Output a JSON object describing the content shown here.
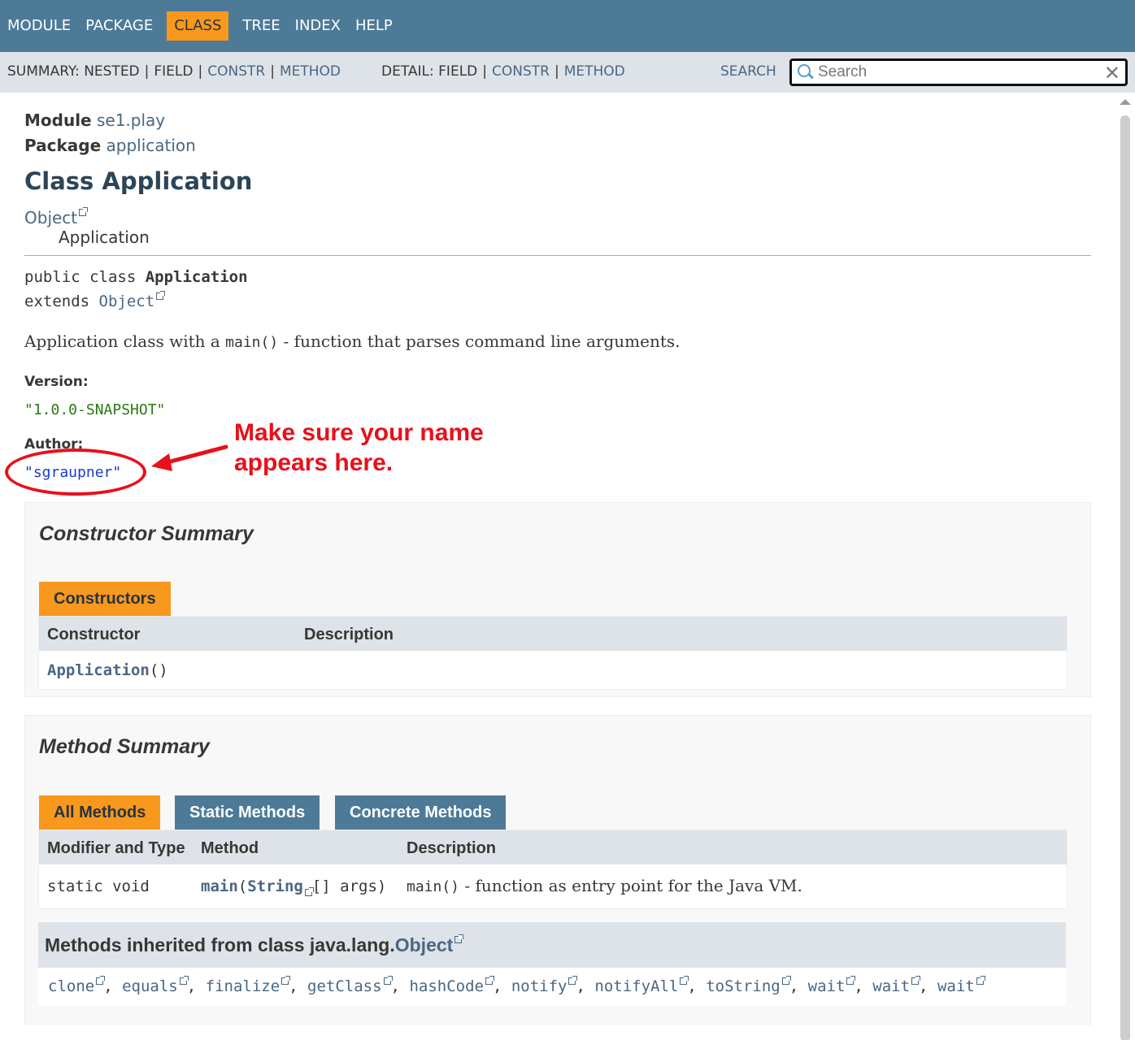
{
  "nav": {
    "items": [
      "MODULE",
      "PACKAGE",
      "CLASS",
      "TREE",
      "INDEX",
      "HELP"
    ],
    "active": "CLASS"
  },
  "subnav": {
    "summary_label": "SUMMARY:",
    "summary_items": [
      "NESTED",
      "FIELD",
      "CONSTR",
      "METHOD"
    ],
    "detail_label": "DETAIL:",
    "detail_items": [
      "FIELD",
      "CONSTR",
      "METHOD"
    ],
    "search_label": "SEARCH",
    "search_placeholder": "Search"
  },
  "header": {
    "module_label": "Module",
    "module_name": "se1.play",
    "package_label": "Package",
    "package_name": "application",
    "class_title": "Class Application",
    "inheritance": [
      "Object",
      "Application"
    ]
  },
  "signature": {
    "line1_prefix": "public class ",
    "line1_name": "Application",
    "line2_prefix": "extends ",
    "line2_link": "Object"
  },
  "description": {
    "pre": "Application class with a ",
    "code": "main()",
    "post": " - function that parses command line arguments."
  },
  "tags": {
    "version_label": "Version:",
    "version_value": "\"1.0.0-SNAPSHOT\"",
    "author_label": "Author:",
    "author_value": "\"sgraupner\""
  },
  "annotation": {
    "text_line1": "Make sure your name",
    "text_line2": "appears here.",
    "color": "#e8101a"
  },
  "constructor_summary": {
    "title": "Constructor Summary",
    "tab": "Constructors",
    "headers": [
      "Constructor",
      "Description"
    ],
    "rows": [
      {
        "name": "Application",
        "params": "()",
        "description": ""
      }
    ]
  },
  "method_summary": {
    "title": "Method Summary",
    "tabs": [
      "All Methods",
      "Static Methods",
      "Concrete Methods"
    ],
    "headers": [
      "Modifier and Type",
      "Method",
      "Description"
    ],
    "rows": [
      {
        "modifier": "static void",
        "method": "main",
        "param_type": "String",
        "param_rest": "[] args)",
        "desc_code": "main()",
        "desc_text": " - function as entry point for the Java VM."
      }
    ],
    "inherited_title_prefix": "Methods inherited from class java.lang.",
    "inherited_title_link": "Object",
    "inherited_methods": [
      "clone",
      "equals",
      "finalize",
      "getClass",
      "hashCode",
      "notify",
      "notifyAll",
      "toString",
      "wait",
      "wait",
      "wait"
    ]
  },
  "colors": {
    "nav_bg": "#4d7a97",
    "active_tab": "#f8981d",
    "subnav_bg": "#dee3e9",
    "link": "#4a6782"
  }
}
